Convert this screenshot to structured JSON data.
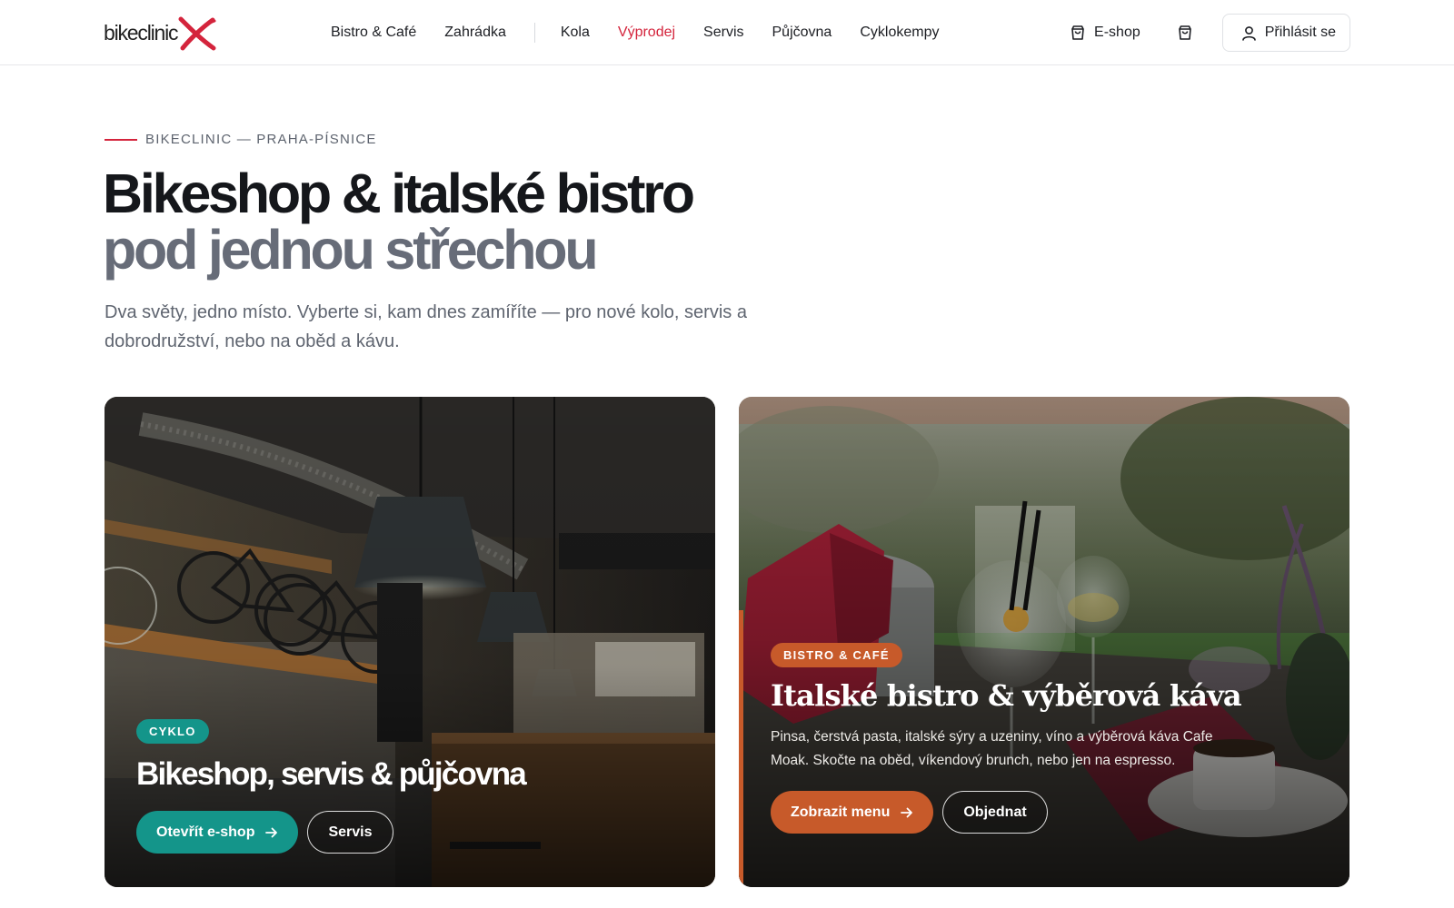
{
  "brand": {
    "logo_text": "bikeclinic",
    "accent": "#d4243c"
  },
  "nav": {
    "items": [
      {
        "label": "Bistro & Café"
      },
      {
        "label": "Zahrádka"
      },
      {
        "label": "Kola"
      },
      {
        "label": "Výprodej"
      },
      {
        "label": "Servis"
      },
      {
        "label": "Půjčovna"
      },
      {
        "label": "Cyklokempy"
      }
    ],
    "eshop_label": "E-shop",
    "cart_icon": "shopping-bag-icon",
    "login_label": "Přihlásit se"
  },
  "hero": {
    "eyebrow": "BIKECLINIC — PRAHA-PÍSNICE",
    "title_main": "Bikeshop & italské bistro ",
    "title_muted": "pod jednou střechou",
    "lead": "Dva světy, jedno místo. Vyberte si, kam dnes zamíříte — pro nové kolo, servis a dobrodružství, nebo na oběd a kávu."
  },
  "cards": [
    {
      "badge": "CYKLO",
      "title": "Bikeshop, servis & půjčovna",
      "primary_label": "Otevřít e-shop",
      "secondary_label": "Servis",
      "color": "#14958a"
    },
    {
      "badge": "BISTRO & CAFÉ",
      "title": "Italské bistro & výběrová káva",
      "description": "Pinsa, čerstvá pasta, italské sýry a uzeniny, víno a výběrová káva Cafe Moak. Skočte na oběd, víkendový brunch, nebo jen na espresso.",
      "primary_label": "Zobrazit menu",
      "secondary_label": "Objednat",
      "color": "#c75a2a"
    }
  ]
}
